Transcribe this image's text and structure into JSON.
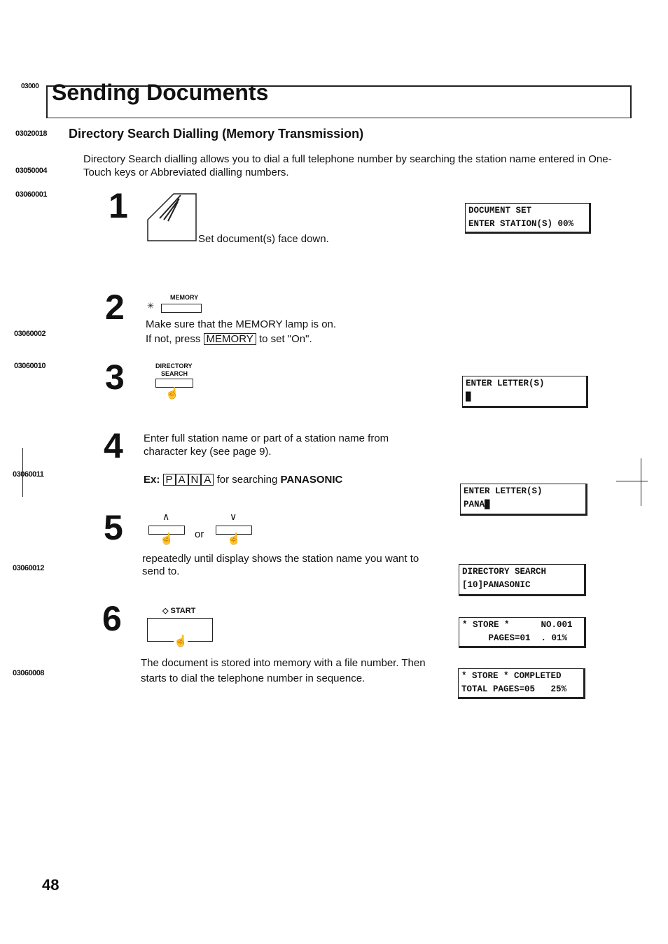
{
  "section_code": "03000",
  "title": "Sending Documents",
  "subsection_code": "03020018",
  "subsection": "Directory Search Dialling (Memory Transmission)",
  "intro_code": "03050004",
  "intro": "Directory Search dialling allows you to dial a full telephone number by searching the station name entered in One-Touch keys or Abbreviated dialling numbers.",
  "side_codes": [
    "03060001",
    "03060002",
    "03060010",
    "03060011",
    "03060012",
    "03060008"
  ],
  "steps": [
    {
      "n": "1",
      "text": "Set document(s) face down."
    },
    {
      "n": "2",
      "label": "MEMORY",
      "line1": "Make sure that the MEMORY lamp is on.",
      "line2a": "If not, press",
      "key": "MEMORY",
      "line2b": "to set \"On\"."
    },
    {
      "n": "3",
      "label1": "DIRECTORY",
      "label2": "SEARCH"
    },
    {
      "n": "4",
      "text": "Enter full station name or part of a station name from character key (see page 9).",
      "ex": "Ex:",
      "keys": [
        "P",
        "A",
        "N",
        "A"
      ],
      "ex_after": "for searching",
      "ex_bold": "PANASONIC"
    },
    {
      "n": "5",
      "up": "∧",
      "down": "∨",
      "or": "or",
      "text": "repeatedly until display shows the station name you want to send to."
    },
    {
      "n": "6",
      "label": "START",
      "text": "The document is stored into memory with a file number. Then starts to dial the telephone number in sequence."
    }
  ],
  "displays": [
    [
      "DOCUMENT SET",
      "ENTER STATION(S) 00%"
    ],
    [
      "ENTER LETTER(S)",
      "█"
    ],
    [
      "ENTER LETTER(S)",
      "PANA█"
    ],
    [
      "DIRECTORY SEARCH",
      "[10]PANASONIC"
    ],
    [
      "* STORE *      NO.001",
      "     PAGES=01  . 01%"
    ],
    [
      "* STORE * COMPLETED",
      "TOTAL PAGES=05   25%"
    ]
  ],
  "page_number": "48"
}
